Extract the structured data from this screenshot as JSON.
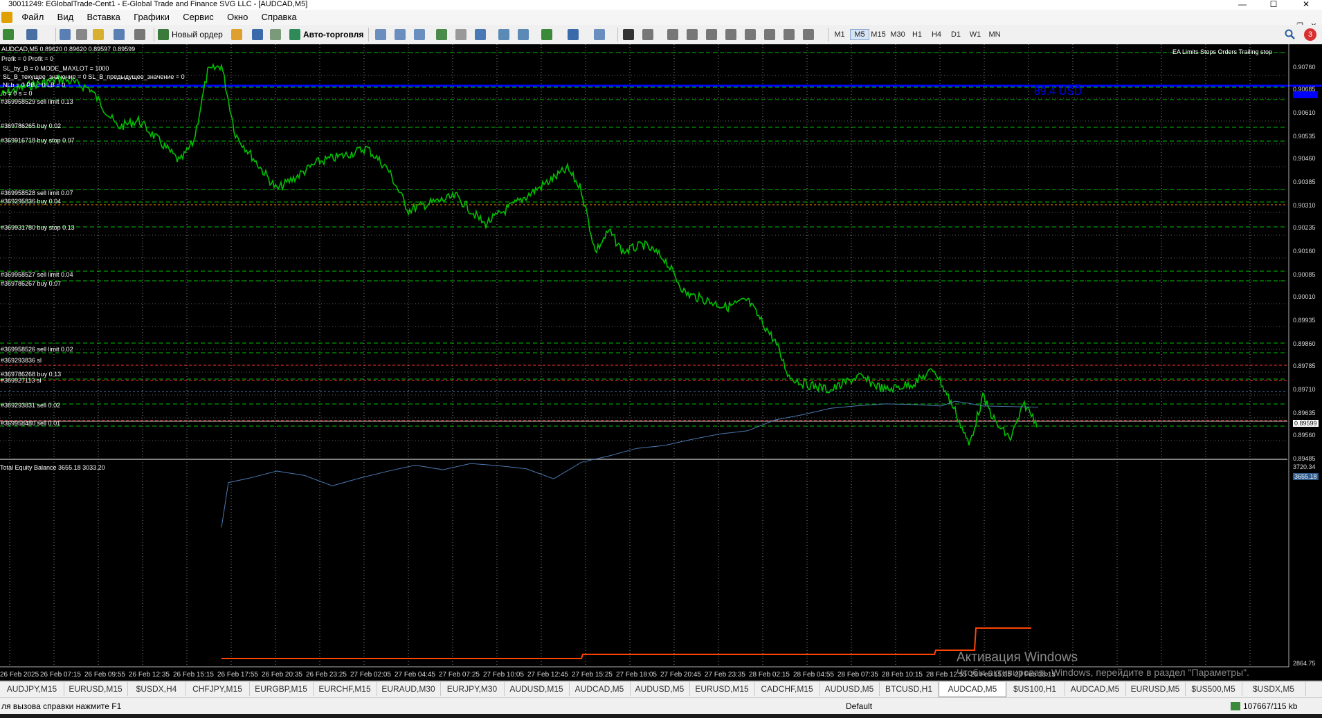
{
  "window": {
    "title": "30011249: EGlobalTrade-Cent1 - E-Global Trade and Finance SVG LLC - [AUDCAD,M5]",
    "minimize": "—",
    "maximize": "☐",
    "close": "✕"
  },
  "menu": [
    "Файл",
    "Вид",
    "Вставка",
    "Графики",
    "Сервис",
    "Окно",
    "Справка"
  ],
  "toolbar": {
    "new_order": "Новый ордер",
    "auto_trading": "Авто-торговля",
    "timeframes": [
      "M1",
      "M5",
      "M15",
      "M30",
      "H1",
      "H4",
      "D1",
      "W1",
      "MN"
    ],
    "active_timeframe": "M5",
    "notification_count": "3"
  },
  "chart": {
    "header": "AUDCAD,M5  0.89620 0.89620 0.89597 0.89599",
    "ea_label": "EA Limits Stops Orders Trailing stop",
    "profit_label": "89.4 USD",
    "info_lines": [
      "Profit = 0 Profit = 0",
      "SL_by_B = 0 MODE_MAXLOT = 1000",
      "SL_B_текущее_значение = 0 SL_B_предыдущее_значение = 0",
      "NLb = 0 PB = 0 LB = 0",
      "b = 0 s = 0"
    ],
    "order_labels": [
      "#369958529 sell limit 0.13",
      "#369786265 buy 0.02",
      "#369916718 buy stop 0.07",
      "#369958528 sell limit 0.07",
      "#369295836 buy 0.04",
      "#369931780 buy stop 0.13",
      "#369958527 sell limit 0.04",
      "#369786267 buy 0.07",
      "#369958526 sell limit 0.02",
      "#369293836 sl",
      "#369786268 buy 0.13",
      "#369927113 sl",
      "#369293831 sell 0.02",
      "#369958480 sell 0.01"
    ],
    "price_scale": [
      "0.90760",
      "0.90685",
      "0.90610",
      "0.90535",
      "0.90460",
      "0.90385",
      "0.90310",
      "0.90235",
      "0.90160",
      "0.90085",
      "0.90010",
      "0.89935",
      "0.89860",
      "0.89785",
      "0.89710",
      "0.89635",
      "0.89560",
      "0.89485"
    ],
    "current_price": "0.89599",
    "indicator_title": "Total Equity Balance 3655.18 3033.20",
    "indicator_top": "3720.34",
    "indicator_value": "3655.18",
    "indicator_bottom": "2864.75",
    "time_labels": [
      "26 Feb 2025",
      "26 Feb 07:15",
      "26 Feb 09:55",
      "26 Feb 12:35",
      "26 Feb 15:15",
      "26 Feb 17:55",
      "26 Feb 20:35",
      "26 Feb 23:25",
      "27 Feb 02:05",
      "27 Feb 04:45",
      "27 Feb 07:25",
      "27 Feb 10:05",
      "27 Feb 12:45",
      "27 Feb 15:25",
      "27 Feb 18:05",
      "27 Feb 20:45",
      "27 Feb 23:35",
      "28 Feb 02:15",
      "28 Feb 04:55",
      "28 Feb 07:35",
      "28 Feb 10:15",
      "28 Feb 12:55",
      "28 Feb 15:35",
      "28 Feb 18:15"
    ],
    "colors": {
      "price_line": "#00c000",
      "equity": "#4a78b0",
      "balance": "#ff4500",
      "grid": "#c0c0c0",
      "highlight": "#0000ff"
    }
  },
  "activation": {
    "title": "Активация Windows",
    "subtitle": "Чтобы активировать Windows, перейдите в раздел \"Параметры\"."
  },
  "tabs": [
    "AUDJPY,M15",
    "EURUSD,M15",
    "$USDX,H4",
    "CHFJPY,M15",
    "EURGBP,M15",
    "EURCHF,M15",
    "EURAUD,M30",
    "EURJPY,M30",
    "AUDUSD,M15",
    "AUDCAD,M5",
    "AUDUSD,M5",
    "EURUSD,M15",
    "CADCHF,M15",
    "AUDUSD,M5",
    "BTCUSD,H1",
    "AUDCAD,M5",
    "$US100,H1",
    "AUDCAD,M5",
    "EURUSD,M5",
    "$US500,M5",
    "$USDX,M5"
  ],
  "active_tab_index": 15,
  "status": {
    "help": "ля вызова справки нажмите F1",
    "profile": "Default",
    "traffic": "107667/115 kb"
  }
}
